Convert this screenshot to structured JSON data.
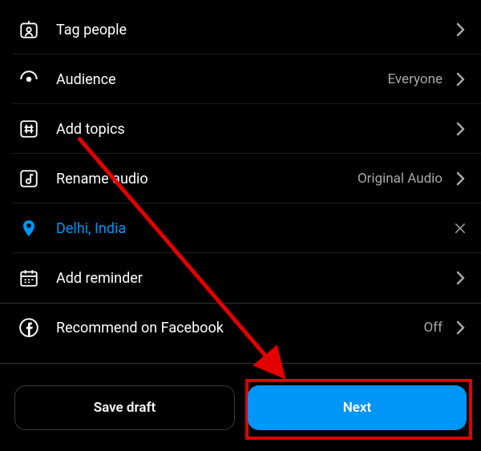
{
  "rows": {
    "tag_people": {
      "label": "Tag people"
    },
    "audience": {
      "label": "Audience",
      "value": "Everyone"
    },
    "add_topics": {
      "label": "Add topics"
    },
    "rename_audio": {
      "label": "Rename audio",
      "value": "Original Audio"
    },
    "location": {
      "label": "Delhi, India"
    },
    "reminder": {
      "label": "Add reminder"
    },
    "recommend": {
      "label": "Recommend on Facebook",
      "value": "Off"
    }
  },
  "footer": {
    "save_draft_label": "Save draft",
    "next_label": "Next"
  },
  "colors": {
    "accent": "#0095f6",
    "annotation": "#e30000"
  }
}
